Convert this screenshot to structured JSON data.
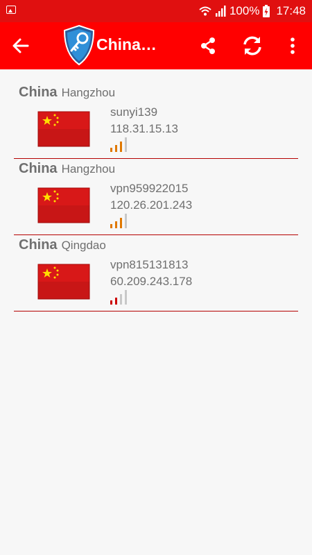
{
  "status_bar": {
    "battery_percent": "100%",
    "time": "17:48",
    "icons": [
      "gallery-icon",
      "wifi-icon",
      "cellular-signal-icon",
      "battery-charging-icon"
    ]
  },
  "app_bar": {
    "title": "China…",
    "back_icon": "back-arrow-icon",
    "logo_icon": "shield-key-logo",
    "share_icon": "share-icon",
    "refresh_icon": "refresh-icon",
    "more_icon": "more-vert-icon",
    "colors": {
      "background": "#ff0000",
      "status_bar": "#e01010"
    }
  },
  "servers": [
    {
      "country": "China",
      "city": "Hangzhou",
      "host": "sunyi139",
      "ip": "118.31.15.13",
      "signal_level": 3,
      "signal_color": "#e07800"
    },
    {
      "country": "China",
      "city": "Hangzhou",
      "host": "vpn959922015",
      "ip": "120.26.201.243",
      "signal_level": 3,
      "signal_color": "#e07800"
    },
    {
      "country": "China",
      "city": "Qingdao",
      "host": "vpn815131813",
      "ip": "60.209.243.178",
      "signal_level": 2,
      "signal_color": "#cc0000"
    }
  ]
}
